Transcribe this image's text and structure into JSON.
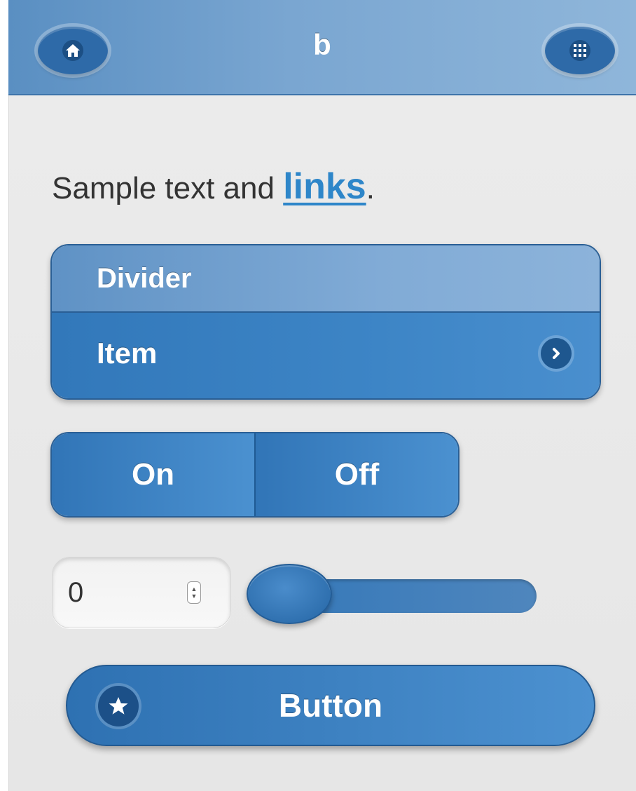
{
  "header": {
    "title": "b",
    "home_icon": "home-icon",
    "menu_icon": "grid-icon"
  },
  "content": {
    "sample_text": "Sample text and ",
    "link_text": "links",
    "sample_end": "."
  },
  "listview": {
    "divider_label": "Divider",
    "item_label": "Item",
    "item_icon": "chevron-right-icon"
  },
  "toggle": {
    "on_label": "On",
    "off_label": "Off"
  },
  "number_input": {
    "value": "0"
  },
  "slider": {
    "value_fraction": 0.0
  },
  "button": {
    "label": "Button",
    "icon": "star-icon"
  },
  "colors": {
    "theme_blue": "#3d85c6",
    "header_blue": "#7aa6d1",
    "link_blue": "#2e86c9",
    "background": "#e9e9e9"
  }
}
